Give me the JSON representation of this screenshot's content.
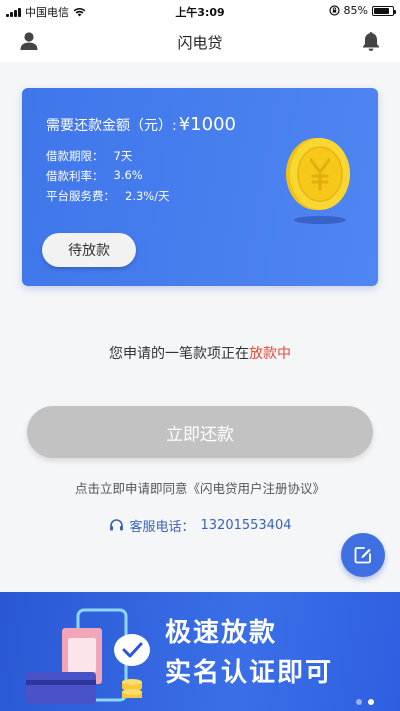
{
  "status_bar": {
    "carrier": "中国电信",
    "time": "上午3:09",
    "battery": "85%",
    "battery_level": 0.85
  },
  "nav": {
    "title": "闪电贷",
    "user_icon": "user-icon",
    "bell_icon": "bell-icon"
  },
  "loan_card": {
    "amount_label": "需要还款金额（元）:",
    "amount_value": "¥1000",
    "details": [
      {
        "label": "借款期限：",
        "value": "7天"
      },
      {
        "label": "借款利率：",
        "value": "3.6%"
      },
      {
        "label": "平台服务费：",
        "value": "2.3%/天"
      }
    ],
    "pending_label": "待放款",
    "coin_icon": "yuan-coin-icon"
  },
  "status_message": {
    "prefix": "您申请的一笔款项正在",
    "highlight": "放款中"
  },
  "repay_button": "立即还款",
  "agreement_text": "点击立即申请即同意《闪电贷用户注册协议》",
  "service": {
    "label": "客服电话：",
    "phone": "13201553404",
    "icon": "headset-icon"
  },
  "fab": {
    "icon": "edit-icon"
  },
  "banner": {
    "line1": "极速放款",
    "line2": "实名认证即可",
    "dots_total": 2,
    "active_dot": 1
  },
  "colors": {
    "primary": "#3f76ea",
    "highlight": "#e64a3b",
    "disabled_button": "#c2c2c2",
    "service_text": "#3a63b8"
  }
}
